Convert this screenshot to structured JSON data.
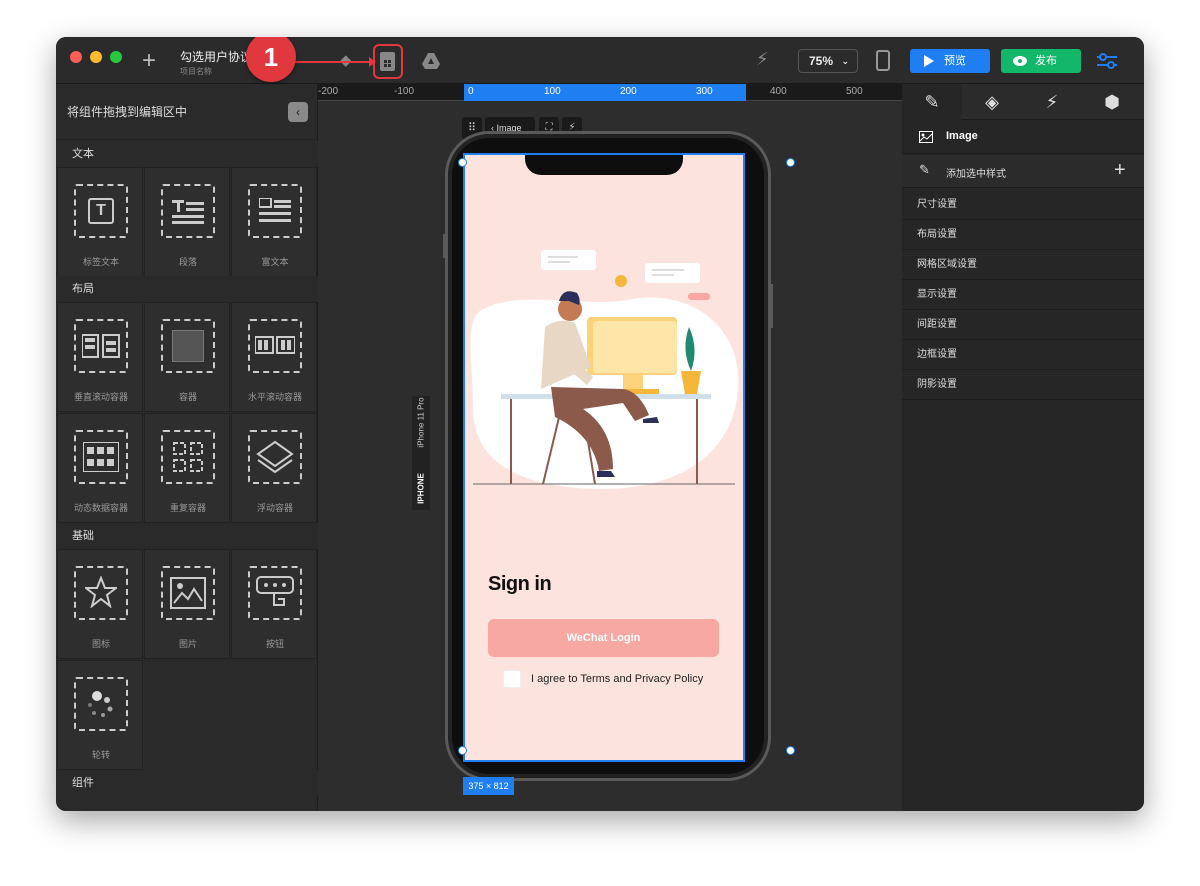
{
  "app": {
    "project_title": "勾选用户协议",
    "project_subtitle": "项目名称",
    "zoom": "75%",
    "preview_label": "预览",
    "publish_label": "发布",
    "callout_number": "1"
  },
  "colors": {
    "accent_blue": "#1e7ef2",
    "publish_green": "#12b76a",
    "highlight_red": "#e0383e",
    "phone_bg": "#fde3de",
    "button_pink": "#f7a8a3"
  },
  "left_panel": {
    "title": "将组件拖拽到编辑区中",
    "sections": [
      {
        "name": "文本",
        "items": [
          "标签文本",
          "段落",
          "富文本"
        ]
      },
      {
        "name": "布局",
        "items": [
          "垂直滚动容器",
          "容器",
          "水平滚动容器",
          "动态数据容器",
          "重复容器",
          "浮动容器"
        ]
      },
      {
        "name": "基础",
        "items": [
          "图标",
          "图片",
          "按钮",
          "轮转"
        ]
      },
      {
        "name": "组件",
        "items": []
      }
    ]
  },
  "ruler": {
    "labels": [
      "-200",
      "-100",
      "0",
      "100",
      "200",
      "300",
      "400",
      "500"
    ]
  },
  "canvas": {
    "toolbar_label": "Image",
    "device_name": "iPhone 11 Pro",
    "device_type": "IPHONE",
    "size_badge": "375 × 812"
  },
  "phone": {
    "heading": "Sign in",
    "login_button": "WeChat Login",
    "agree_text": "I agree to Terms and Privacy Policy"
  },
  "right_panel": {
    "selected": "Image",
    "add_style": "添加选中样式",
    "rows": [
      "尺寸设置",
      "布局设置",
      "网格区域设置",
      "显示设置",
      "间距设置",
      "边框设置",
      "阴影设置"
    ]
  }
}
